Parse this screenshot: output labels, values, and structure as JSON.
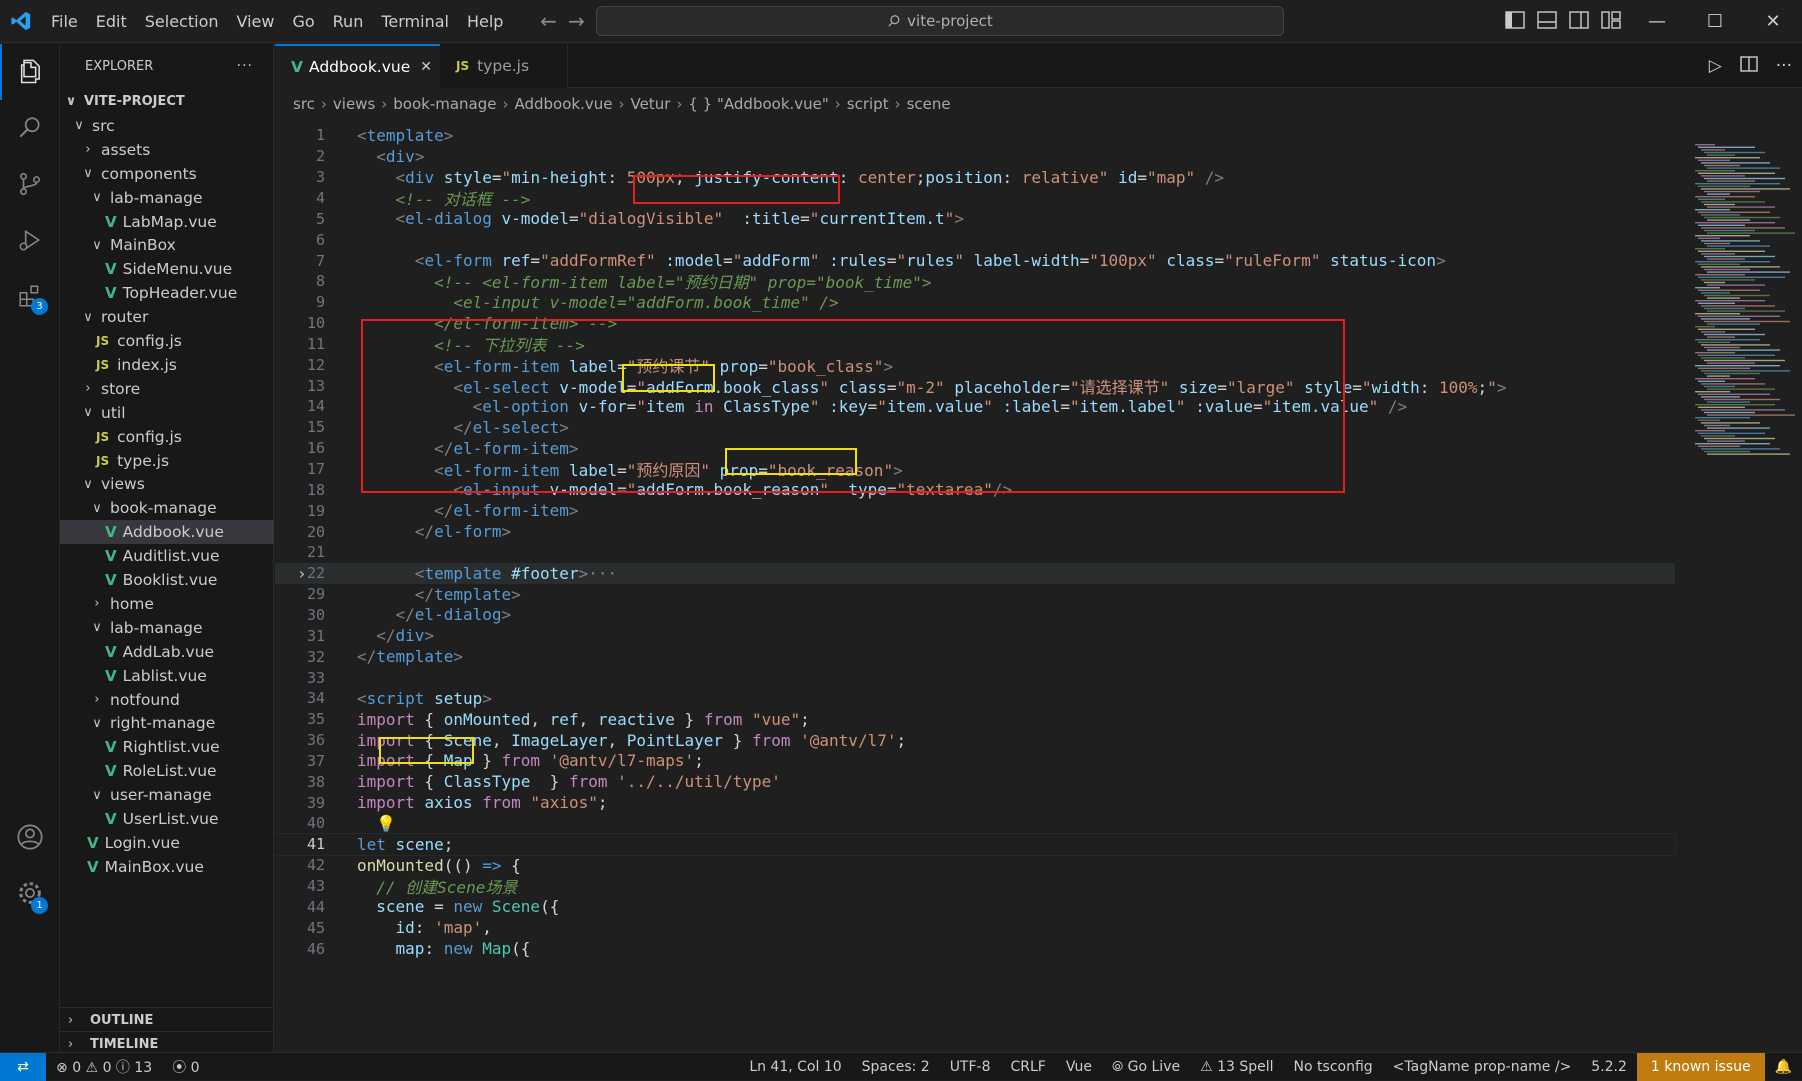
{
  "menu": [
    "File",
    "Edit",
    "Selection",
    "View",
    "Go",
    "Run",
    "Terminal",
    "Help"
  ],
  "search": {
    "text": "vite-project"
  },
  "activity_badges": {
    "extensions": "3",
    "settings": "1"
  },
  "explorer": {
    "title": "EXPLORER",
    "more": "···",
    "project": "VITE-PROJECT",
    "items": [
      {
        "label": "src",
        "kind": "folder-open",
        "depth": 0
      },
      {
        "label": "assets",
        "kind": "folder",
        "depth": 1
      },
      {
        "label": "components",
        "kind": "folder-open",
        "depth": 1
      },
      {
        "label": "lab-manage",
        "kind": "folder-open",
        "depth": 2
      },
      {
        "label": "LabMap.vue",
        "kind": "vue",
        "depth": 3
      },
      {
        "label": "MainBox",
        "kind": "folder-open",
        "depth": 2
      },
      {
        "label": "SideMenu.vue",
        "kind": "vue",
        "depth": 3
      },
      {
        "label": "TopHeader.vue",
        "kind": "vue",
        "depth": 3
      },
      {
        "label": "router",
        "kind": "folder-open",
        "depth": 1
      },
      {
        "label": "config.js",
        "kind": "js",
        "depth": 2
      },
      {
        "label": "index.js",
        "kind": "js",
        "depth": 2
      },
      {
        "label": "store",
        "kind": "folder",
        "depth": 1
      },
      {
        "label": "util",
        "kind": "folder-open",
        "depth": 1
      },
      {
        "label": "config.js",
        "kind": "js",
        "depth": 2
      },
      {
        "label": "type.js",
        "kind": "js",
        "depth": 2
      },
      {
        "label": "views",
        "kind": "folder-open",
        "depth": 1
      },
      {
        "label": "book-manage",
        "kind": "folder-open",
        "depth": 2
      },
      {
        "label": "Addbook.vue",
        "kind": "vue",
        "depth": 3,
        "selected": true
      },
      {
        "label": "Auditlist.vue",
        "kind": "vue",
        "depth": 3
      },
      {
        "label": "Booklist.vue",
        "kind": "vue",
        "depth": 3
      },
      {
        "label": "home",
        "kind": "folder",
        "depth": 2
      },
      {
        "label": "lab-manage",
        "kind": "folder-open",
        "depth": 2
      },
      {
        "label": "AddLab.vue",
        "kind": "vue",
        "depth": 3
      },
      {
        "label": "Lablist.vue",
        "kind": "vue",
        "depth": 3
      },
      {
        "label": "notfound",
        "kind": "folder",
        "depth": 2
      },
      {
        "label": "right-manage",
        "kind": "folder-open",
        "depth": 2
      },
      {
        "label": "Rightlist.vue",
        "kind": "vue",
        "depth": 3
      },
      {
        "label": "RoleList.vue",
        "kind": "vue",
        "depth": 3
      },
      {
        "label": "user-manage",
        "kind": "folder-open",
        "depth": 2
      },
      {
        "label": "UserList.vue",
        "kind": "vue",
        "depth": 3
      },
      {
        "label": "Login.vue",
        "kind": "vue",
        "depth": 1
      },
      {
        "label": "MainBox.vue",
        "kind": "vue",
        "depth": 1
      }
    ],
    "sections": [
      "OUTLINE",
      "TIMELINE"
    ]
  },
  "tabs": [
    {
      "label": "Addbook.vue",
      "icon": "V",
      "active": true,
      "close": "✕"
    },
    {
      "label": "type.js",
      "icon": "JS",
      "active": false
    }
  ],
  "breadcrumbs": [
    "src",
    "views",
    "book-manage",
    "Addbook.vue",
    "Vetur",
    "{ } \"Addbook.vue\"",
    "script",
    "scene"
  ],
  "code_lines": [
    {
      "n": "1",
      "html": "<span class='t-br'>&lt;</span><span class='t-tag'>template</span><span class='t-br'>&gt;</span>"
    },
    {
      "n": "2",
      "html": "  <span class='t-br'>&lt;</span><span class='t-tag'>div</span><span class='t-br'>&gt;</span>"
    },
    {
      "n": "3",
      "html": "    <span class='t-br'>&lt;</span><span class='t-tag'>div</span> <span class='t-at'>style</span>=<span class='t-str'>\"</span><span class='t-at'>min-height</span>: <span class='t-str'>500px</span>; <span class='t-at'>justify-content</span>: <span class='t-str'>center</span>;<span class='t-at'>position</span>: <span class='t-str'>relative</span><span class='t-str'>\"</span> <span class='t-at'>id</span>=<span class='t-str'>\"map\"</span> <span class='t-br'>/&gt;</span>"
    },
    {
      "n": "4",
      "html": "    <span class='t-cm'>&lt;!-- 对话框 --&gt;</span>"
    },
    {
      "n": "5",
      "html": "    <span class='t-br'>&lt;</span><span class='t-tag'>el-dialog</span> <span class='t-at'>v-model</span>=<span class='t-str'>\"dialogVisible\"</span>  <span class='t-at'>:title</span>=<span class='t-str'>\"</span><span class='t-var'>currentItem.t</span><span class='t-str'>\"</span><span class='t-br'>&gt;</span>"
    },
    {
      "n": "6",
      "html": ""
    },
    {
      "n": "7",
      "html": "      <span class='t-br'>&lt;</span><span class='t-tag'>el-form</span> <span class='t-at'>ref</span>=<span class='t-str'>\"addFormRef\"</span> <span class='t-at'>:model</span>=<span class='t-str'>\"</span><span class='t-var'>addForm</span><span class='t-str'>\"</span> <span class='t-at'>:rules</span>=<span class='t-str'>\"</span><span class='t-var'>rules</span><span class='t-str'>\"</span> <span class='t-at'>label-width</span>=<span class='t-str'>\"100px\"</span> <span class='t-at'>class</span>=<span class='t-str'>\"ruleForm\"</span> <span class='t-at'>status-icon</span><span class='t-br'>&gt;</span>"
    },
    {
      "n": "8",
      "html": "        <span class='t-cm'>&lt;!-- &lt;el-form-item label=\"预约日期\" prop=\"book_time\"&gt;</span>"
    },
    {
      "n": "9",
      "html": "<span class='t-cm'>          &lt;el-input v-model=\"addForm.book_time\" /&gt;</span>"
    },
    {
      "n": "10",
      "html": "<span class='t-cm'>        &lt;/el-form-item&gt; --&gt;</span>"
    },
    {
      "n": "11",
      "html": "        <span class='t-cm'>&lt;!-- 下拉列表 --&gt;</span>"
    },
    {
      "n": "12",
      "html": "        <span class='t-br'>&lt;</span><span class='t-tag'>el-form-item</span> <span class='t-at'>label</span>=<span class='t-str'>\"预约课节\"</span> <span class='t-at'>prop</span>=<span class='t-str'>\"book_class\"</span><span class='t-br'>&gt;</span>"
    },
    {
      "n": "13",
      "html": "          <span class='t-br'>&lt;</span><span class='t-tag'>el-select</span> <span class='t-at'>v-model</span>=<span class='t-str'>\"</span><span class='t-var'>addForm.book_class</span><span class='t-str'>\"</span> <span class='t-at'>class</span>=<span class='t-str'>\"m-2\"</span> <span class='t-at'>placeholder</span>=<span class='t-str'>\"请选择课节\"</span> <span class='t-at'>size</span>=<span class='t-str'>\"large\"</span> <span class='t-at'>style</span>=<span class='t-str'>\"</span><span class='t-at'>width</span>: <span class='t-str'>100%</span>;<span class='t-str'>\"</span><span class='t-br'>&gt;</span>"
    },
    {
      "n": "14",
      "html": "            <span class='t-br'>&lt;</span><span class='t-tag'>el-option</span> <span class='t-at'>v-for</span>=<span class='t-str'>\"</span><span class='t-var'>item</span> <span class='t-kw'>in</span> <span class='t-var'>ClassType</span><span class='t-str'>\"</span> <span class='t-at'>:key</span>=<span class='t-str'>\"</span><span class='t-var'>item.value</span><span class='t-str'>\"</span> <span class='t-at'>:label</span>=<span class='t-str'>\"</span><span class='t-var'>item.label</span><span class='t-str'>\"</span> <span class='t-at'>:value</span>=<span class='t-str'>\"</span><span class='t-var'>item.value</span><span class='t-str'>\"</span> <span class='t-br'>/&gt;</span>"
    },
    {
      "n": "15",
      "html": "          <span class='t-br'>&lt;/</span><span class='t-tag'>el-select</span><span class='t-br'>&gt;</span>"
    },
    {
      "n": "16",
      "html": "        <span class='t-br'>&lt;/</span><span class='t-tag'>el-form-item</span><span class='t-br'>&gt;</span>"
    },
    {
      "n": "17",
      "html": "        <span class='t-br'>&lt;</span><span class='t-tag'>el-form-item</span> <span class='t-at'>label</span>=<span class='t-str'>\"预约原因\"</span> <span class='t-at'>prop</span>=<span class='t-str'>\"book_reason\"</span><span class='t-br'>&gt;</span>"
    },
    {
      "n": "18",
      "html": "          <span class='t-br'>&lt;</span><span class='t-tag'>el-input</span> <span class='t-at'>v-model</span>=<span class='t-str'>\"</span><span class='t-var'>addForm.book_reason</span><span class='t-str'>\"</span>  <span class='t-at'>type</span>=<span class='t-str'>\"textarea\"</span><span class='t-br'>/&gt;</span>"
    },
    {
      "n": "19",
      "html": "        <span class='t-br'>&lt;/</span><span class='t-tag'>el-form-item</span><span class='t-br'>&gt;</span>"
    },
    {
      "n": "20",
      "html": "      <span class='t-br'>&lt;/</span><span class='t-tag'>el-form</span><span class='t-br'>&gt;</span>"
    },
    {
      "n": "21",
      "html": ""
    },
    {
      "n": "22",
      "html": "      <span class='t-br'>&lt;</span><span class='t-tag'>template</span> <span class='t-at'>#footer</span><span class='t-br'>&gt;</span><span class='t-br'>···</span>"
    },
    {
      "n": "29",
      "html": "      <span class='t-br'>&lt;/</span><span class='t-tag'>template</span><span class='t-br'>&gt;</span>"
    },
    {
      "n": "30",
      "html": "    <span class='t-br'>&lt;/</span><span class='t-tag'>el-dialog</span><span class='t-br'>&gt;</span>"
    },
    {
      "n": "31",
      "html": "  <span class='t-br'>&lt;/</span><span class='t-tag'>div</span><span class='t-br'>&gt;</span>"
    },
    {
      "n": "32",
      "html": "<span class='t-br'>&lt;/</span><span class='t-tag'>template</span><span class='t-br'>&gt;</span>"
    },
    {
      "n": "33",
      "html": ""
    },
    {
      "n": "34",
      "html": "<span class='t-br'>&lt;</span><span class='t-tag'>script</span> <span class='t-at'>setup</span><span class='t-br'>&gt;</span>"
    },
    {
      "n": "35",
      "html": "<span class='t-kw'>import</span> { <span class='t-var'>onMounted</span>, <span class='t-var'>ref</span>, <span class='t-var'>reactive</span> } <span class='t-kw'>from</span> <span class='t-str'>\"vue\"</span>;"
    },
    {
      "n": "36",
      "html": "<span class='t-kw'>import</span> { <span class='t-var'>Scene</span>, <span class='t-var'>ImageLayer</span>, <span class='t-var'>PointLayer</span> } <span class='t-kw'>from</span> <span class='t-str'>'@antv/l7'</span>;"
    },
    {
      "n": "37",
      "html": "<span class='t-kw'>import</span> { <span class='t-var'>Map</span> } <span class='t-kw'>from</span> <span class='t-str'>'@antv/l7-maps'</span>;"
    },
    {
      "n": "38",
      "html": "<span class='t-kw'>import</span> { <span class='t-var'>ClassType</span>  } <span class='t-kw'>from</span> <span class='t-str'>'../../util/type'</span>"
    },
    {
      "n": "39",
      "html": "<span class='t-kw'>import</span> <span class='t-var'>axios</span> <span class='t-kw'>from</span> <span class='t-str'>\"axios\"</span>;"
    },
    {
      "n": "40",
      "html": "  <span style='color:#f0c419'>💡</span>"
    },
    {
      "n": "41",
      "html": "<span class='t-bl'>let</span> <span class='t-var'>scene</span>;"
    },
    {
      "n": "42",
      "html": "<span class='t-fn'>onMounted</span>(() <span class='t-bl'>=&gt;</span> {"
    },
    {
      "n": "43",
      "html": "  <span class='t-cm'>// 创建Scene场景</span>"
    },
    {
      "n": "44",
      "html": "  <span class='t-var'>scene</span> = <span class='t-bl'>new</span> <span class='t-cls'>Scene</span>({"
    },
    {
      "n": "45",
      "html": "    <span class='t-var'>id</span>: <span class='t-str'>'map'</span>,"
    },
    {
      "n": "46",
      "html": "    <span class='t-var'>map</span>: <span class='t-bl'>new</span> <span class='t-cls'>Map</span>({"
    }
  ],
  "status": {
    "problems": "0",
    "warnings": "0",
    "info": "13",
    "ports": "0",
    "position": "Ln 41, Col 10",
    "spaces": "Spaces: 2",
    "encoding": "UTF-8",
    "eol": "CRLF",
    "language": "Vue",
    "golive": "Go Live",
    "spell": "13 Spell",
    "tsconfig": "No tsconfig",
    "tagname": "<TagName prop-name />",
    "version": "5.2.2",
    "known": "1 known issue"
  }
}
